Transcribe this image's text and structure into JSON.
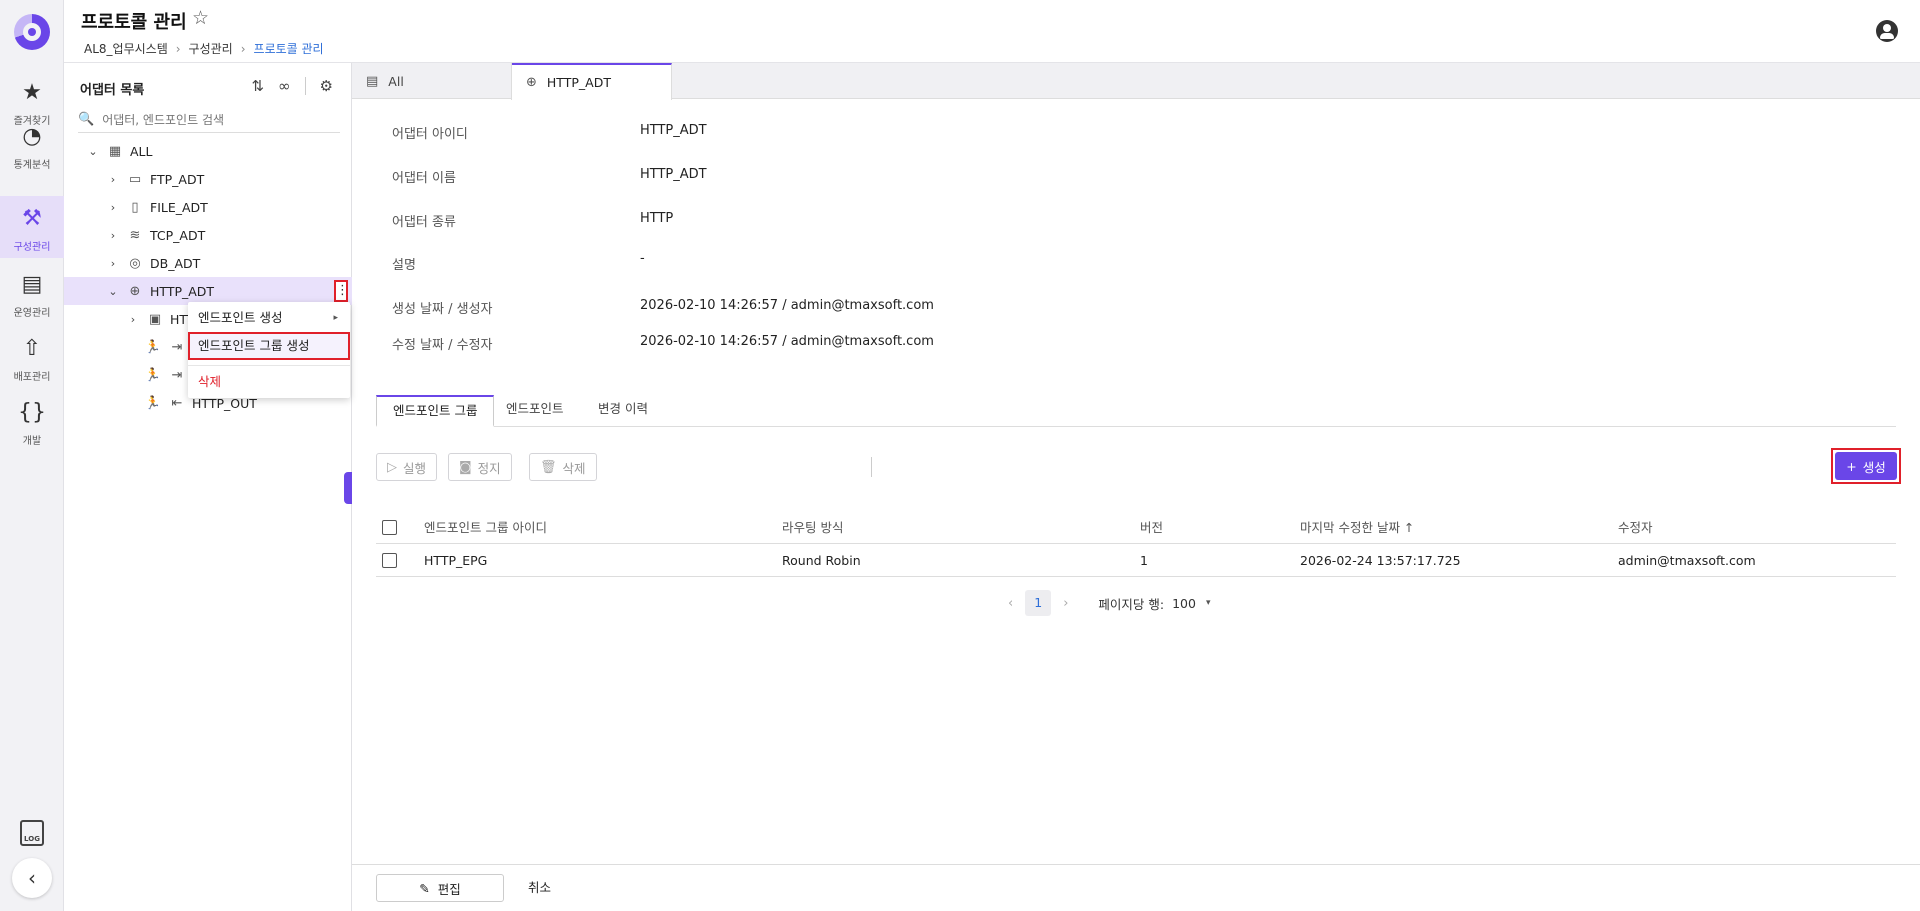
{
  "rail": {
    "items": [
      {
        "label": "즐겨찾기",
        "icon": "★"
      },
      {
        "label": "통계분석",
        "icon": "◔"
      },
      {
        "label": "구성관리",
        "icon": "⚒"
      },
      {
        "label": "운영관리",
        "icon": "▤"
      },
      {
        "label": "배포관리",
        "icon": "⇧"
      },
      {
        "label": "개발",
        "icon": "{}"
      }
    ],
    "log_text": "LOG",
    "collapse_glyph": "‹"
  },
  "header": {
    "title": "프로토콜 관리",
    "star": "☆",
    "breadcrumb": [
      "AL8_업무시스템",
      "구성관리",
      "프로토콜 관리"
    ],
    "sep": "›"
  },
  "tree": {
    "title": "어댑터 목록",
    "tools": [
      "⇅",
      "∞",
      "⚙"
    ],
    "search_placeholder": "어댑터, 엔드포인트 검색",
    "nodes": [
      {
        "label": "ALL",
        "chev": "⌄",
        "icon": "▦"
      },
      {
        "label": "FTP_ADT",
        "chev": "›",
        "icon": "▭"
      },
      {
        "label": "FILE_ADT",
        "chev": "›",
        "icon": "▯"
      },
      {
        "label": "TCP_ADT",
        "chev": "›",
        "icon": "≋"
      },
      {
        "label": "DB_ADT",
        "chev": "›",
        "icon": "◎"
      },
      {
        "label": "HTTP_ADT",
        "chev": "⌄",
        "icon": "⊕"
      },
      {
        "label": "HTT",
        "chev": "›",
        "icon": "▣"
      },
      {
        "label": "",
        "icon": "⇥"
      },
      {
        "label": "",
        "icon": "⇥"
      },
      {
        "label": "HTTP_OUT",
        "icon": "⇤"
      }
    ],
    "kebab": "⋮",
    "runner": "🏃"
  },
  "context_menu": {
    "items": [
      "엔드포인트 생성",
      "엔드포인트 그룹 생성",
      "삭제"
    ],
    "arrow": "▸"
  },
  "top_tabs": [
    {
      "label": "All",
      "icon": "▤"
    },
    {
      "label": "HTTP_ADT",
      "icon": "⊕"
    }
  ],
  "info": [
    {
      "label": "어댑터 아이디",
      "value": "HTTP_ADT"
    },
    {
      "label": "어댑터 이름",
      "value": "HTTP_ADT"
    },
    {
      "label": "어댑터 종류",
      "value": "HTTP"
    },
    {
      "label": "설명",
      "value": "-"
    },
    {
      "label": "생성 날짜 / 생성자",
      "value": "2026-02-10 14:26:57 / admin@tmaxsoft.com"
    },
    {
      "label": "수정 날짜 / 수정자",
      "value": "2026-02-10 14:26:57 / admin@tmaxsoft.com"
    }
  ],
  "sub_tabs": [
    "엔드포인트 그룹",
    "엔드포인트",
    "변경 이력"
  ],
  "actions": {
    "run": "실행",
    "stop": "정지",
    "delete": "삭제",
    "create": "생성"
  },
  "table": {
    "columns": [
      "엔드포인트 그룹 아이디",
      "라우팅 방식",
      "버전",
      "마지막 수정한 날짜 ↑",
      "수정자"
    ],
    "rows": [
      [
        "HTTP_EPG",
        "Round Robin",
        "1",
        "2026-02-24 13:57:17.725",
        "admin@tmaxsoft.com"
      ]
    ]
  },
  "pager": {
    "prev": "‹",
    "page": "1",
    "next": "›",
    "rows_label": "페이지당 행:",
    "rows_value": "100",
    "dd": "▾"
  },
  "footer": {
    "edit": "편집",
    "cancel": "취소"
  },
  "colors": {
    "accent": "#6a46e8",
    "highlight": "#e0202a",
    "link": "#2f6fd8"
  }
}
